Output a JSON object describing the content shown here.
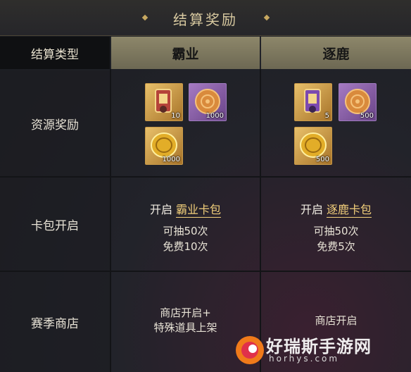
{
  "title": "结算奖励",
  "header": {
    "type_label": "结算类型",
    "col_a": "霸业",
    "col_b": "逐鹿"
  },
  "rows": {
    "resource_label": "资源奖励",
    "pack_label": "卡包开启",
    "shop_label": "赛季商店"
  },
  "col_a": {
    "items": [
      {
        "icon": "token-icon",
        "count": "10"
      },
      {
        "icon": "mooncake-icon",
        "count": "1000"
      },
      {
        "icon": "gold-coin-icon",
        "count": "1000"
      }
    ],
    "pack_prefix": "开启",
    "pack_name": "霸业卡包",
    "draws": "可抽50次",
    "free": "免费10次",
    "shop_line1": "商店开启+",
    "shop_line2": "特殊道具上架"
  },
  "col_b": {
    "items": [
      {
        "icon": "token-icon",
        "count": "5"
      },
      {
        "icon": "mooncake-icon",
        "count": "500"
      },
      {
        "icon": "gold-coin-icon",
        "count": "500"
      }
    ],
    "pack_prefix": "开启",
    "pack_name": "逐鹿卡包",
    "draws": "可抽50次",
    "free": "免费5次",
    "shop_line1": "商店开启"
  },
  "watermark": {
    "text": "好瑞斯手游网",
    "sub": "horhys.com"
  },
  "colors": {
    "accent_gold": "#f2cf7a",
    "header_bg": "#8d876a"
  }
}
